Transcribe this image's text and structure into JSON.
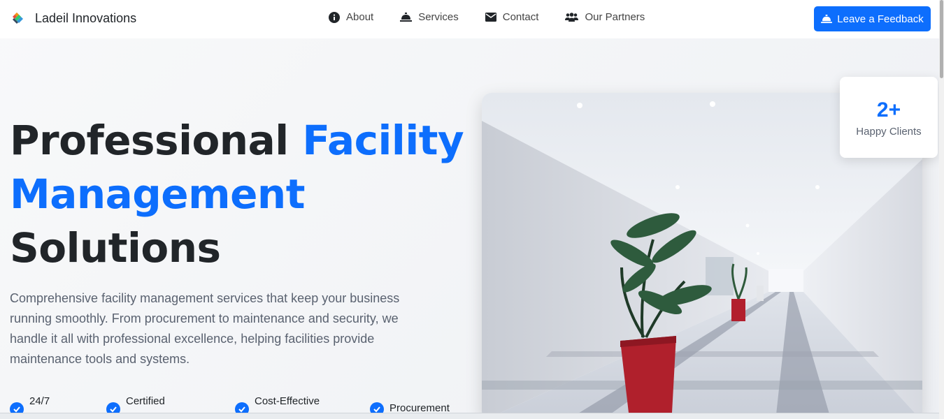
{
  "brand": {
    "name": "Ladeil Innovations",
    "logo_icon": "colorful-cube-logo"
  },
  "nav": {
    "items": [
      {
        "label": "About",
        "icon": "info-circle-icon"
      },
      {
        "label": "Services",
        "icon": "service-bell-icon"
      },
      {
        "label": "Contact",
        "icon": "envelope-icon"
      },
      {
        "label": "Our Partners",
        "icon": "users-icon"
      }
    ],
    "feedback_label": "Leave a Feedback",
    "feedback_icon": "service-bell-icon"
  },
  "hero": {
    "title_part1": "Professional ",
    "title_accent1": "Facility",
    "title_accent2": "Management",
    "title_part2": "Solutions",
    "description": "Comprehensive facility management services that keep your business running smoothly. From procurement to maintenance and security, we handle it all with professional excellence, helping facilities provide maintenance tools and systems.",
    "features": [
      {
        "label": "24/7"
      },
      {
        "label": "Certified"
      },
      {
        "label": "Cost-Effective"
      },
      {
        "label": "Procurement"
      }
    ]
  },
  "stat": {
    "value": "2+",
    "label": "Happy Clients"
  },
  "colors": {
    "accent": "#0d6efd",
    "text": "#212529",
    "muted": "#5a6270"
  }
}
